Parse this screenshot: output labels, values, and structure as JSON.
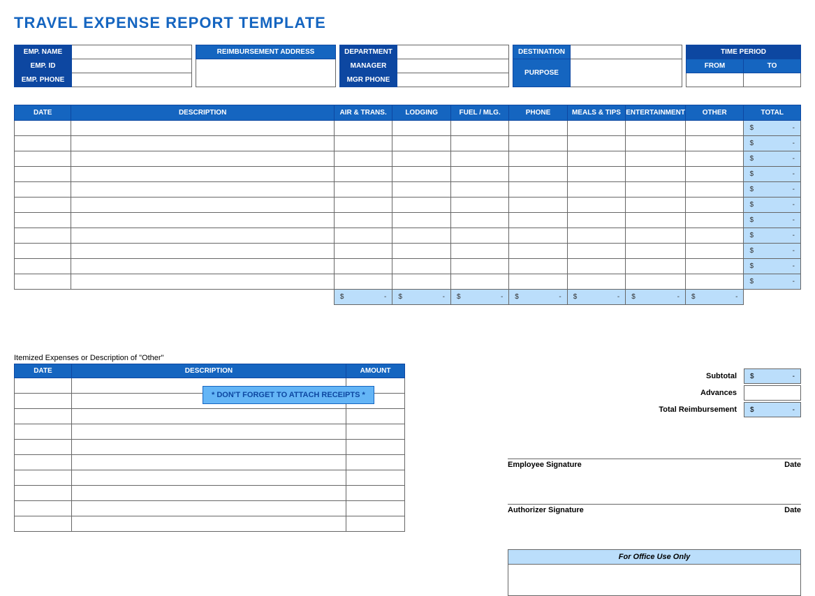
{
  "title": "TRAVEL EXPENSE REPORT TEMPLATE",
  "info": {
    "emp_name": "EMP. NAME",
    "emp_id": "EMP. ID",
    "emp_phone": "EMP. PHONE",
    "reimb_address": "REIMBURSEMENT ADDRESS",
    "department": "DEPARTMENT",
    "manager": "MANAGER",
    "mgr_phone": "MGR PHONE",
    "destination": "DESTINATION",
    "purpose": "PURPOSE",
    "time_period": "TIME PERIOD",
    "from": "FROM",
    "to": "TO"
  },
  "expense_headers": {
    "date": "DATE",
    "description": "DESCRIPTION",
    "air_trans": "AIR & TRANS.",
    "lodging": "LODGING",
    "fuel_mlg": "FUEL / MLG.",
    "phone": "PHONE",
    "meals_tips": "MEALS & TIPS",
    "entertainment": "ENTERTAINMENT",
    "other": "OTHER",
    "total": "TOTAL"
  },
  "expense_rows": 11,
  "money_placeholder_dollar": "$",
  "money_placeholder_dash": "-",
  "summary": {
    "subtotal": "Subtotal",
    "advances": "Advances",
    "total_reimb": "Total Reimbursement"
  },
  "receipts_note": "* DON'T FORGET TO ATTACH RECEIPTS *",
  "itemized_label": "Itemized Expenses or Description of \"Other\"",
  "itemized_headers": {
    "date": "DATE",
    "description": "DESCRIPTION",
    "amount": "AMOUNT"
  },
  "itemized_rows": 10,
  "signatures": {
    "employee": "Employee Signature",
    "authorizer": "Authorizer Signature",
    "date": "Date"
  },
  "office_use": "For Office Use Only"
}
